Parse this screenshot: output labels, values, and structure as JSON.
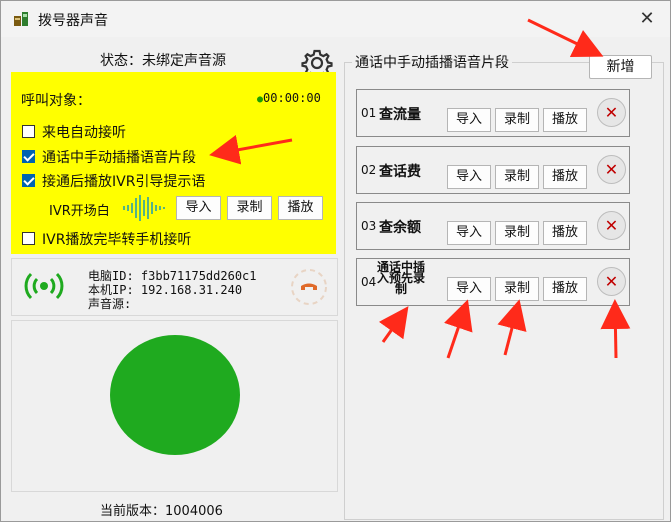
{
  "window": {
    "title": "拨号器声音",
    "close_glyph": "✕"
  },
  "status": {
    "label": "状态：",
    "value": "未绑定声音源"
  },
  "call_target": {
    "label": "呼叫对象：",
    "timer": "00:00:00"
  },
  "options": [
    {
      "label": "来电自动接听",
      "checked": false
    },
    {
      "label": "通话中手动插播语音片段",
      "checked": true
    },
    {
      "label": "接通后播放IVR引导提示语",
      "checked": true
    }
  ],
  "ivr": {
    "label": "IVR开场白",
    "import": "导入",
    "record": "录制",
    "play": "播放"
  },
  "ivr_transfer": {
    "label": "IVR播放完毕转手机接听",
    "checked": false
  },
  "device": {
    "pc_id": "电脑ID: f3bb71175dd260c1",
    "ip": "本机IP: 192.168.31.240",
    "source": "声音源:"
  },
  "version": {
    "label": "当前版本：",
    "value": "1004006"
  },
  "segments_panel": {
    "title": "通话中手动插播语音片段",
    "add_label": "新增"
  },
  "segments": [
    {
      "num": "01",
      "name": "查流量",
      "import": "导入",
      "record": "录制",
      "play": "播放"
    },
    {
      "num": "02",
      "name": "查话费",
      "import": "导入",
      "record": "录制",
      "play": "播放"
    },
    {
      "num": "03",
      "name": "查余额",
      "import": "导入",
      "record": "录制",
      "play": "播放"
    },
    {
      "num": "04",
      "name": "通话中插入预先录制",
      "import": "导入",
      "record": "录制",
      "play": "播放"
    }
  ],
  "colors": {
    "highlight": "#ffff00",
    "green": "#1faa1f",
    "arrow": "#ff2a1a",
    "delete": "#c00000"
  },
  "icons": [
    "phone-app-icon",
    "gear-icon",
    "wave-icon",
    "signal-icon",
    "phone-handset-icon",
    "close-icon"
  ]
}
